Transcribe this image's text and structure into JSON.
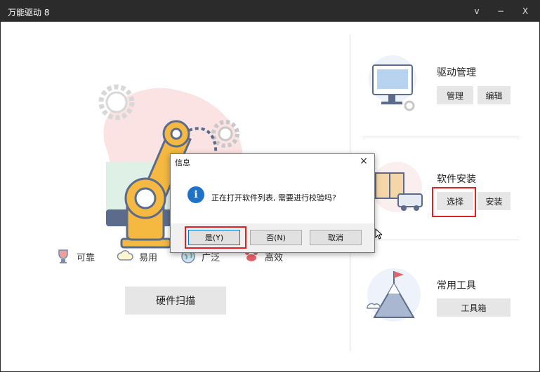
{
  "window": {
    "title": "万能驱动 8"
  },
  "titlebar_controls": {
    "dropdown": "v",
    "minimize": "−",
    "close": "X"
  },
  "main": {
    "features": [
      {
        "label": "可靠",
        "icon": "trophy-icon"
      },
      {
        "label": "易用",
        "icon": "cloud-icon"
      },
      {
        "label": "广泛",
        "icon": "globe-icon"
      },
      {
        "label": "高效",
        "icon": "crab-icon"
      }
    ],
    "scan_button": "硬件扫描"
  },
  "sections": {
    "driver": {
      "title": "驱动管理",
      "btn1": "管理",
      "btn2": "编辑"
    },
    "software": {
      "title": "软件安装",
      "btn1": "选择",
      "btn2": "安装"
    },
    "tools": {
      "title": "常用工具",
      "btn1": "工具箱"
    }
  },
  "dialog": {
    "title": "信息",
    "close": "×",
    "message": "正在打开软件列表, 需要进行校验吗?",
    "yes": "是(Y)",
    "no": "否(N)",
    "cancel": "取消"
  },
  "colors": {
    "titlebar": "#2b2b2b",
    "accent": "#1e73c8",
    "highlight": "#dd2222",
    "robot": "#f5b840"
  }
}
